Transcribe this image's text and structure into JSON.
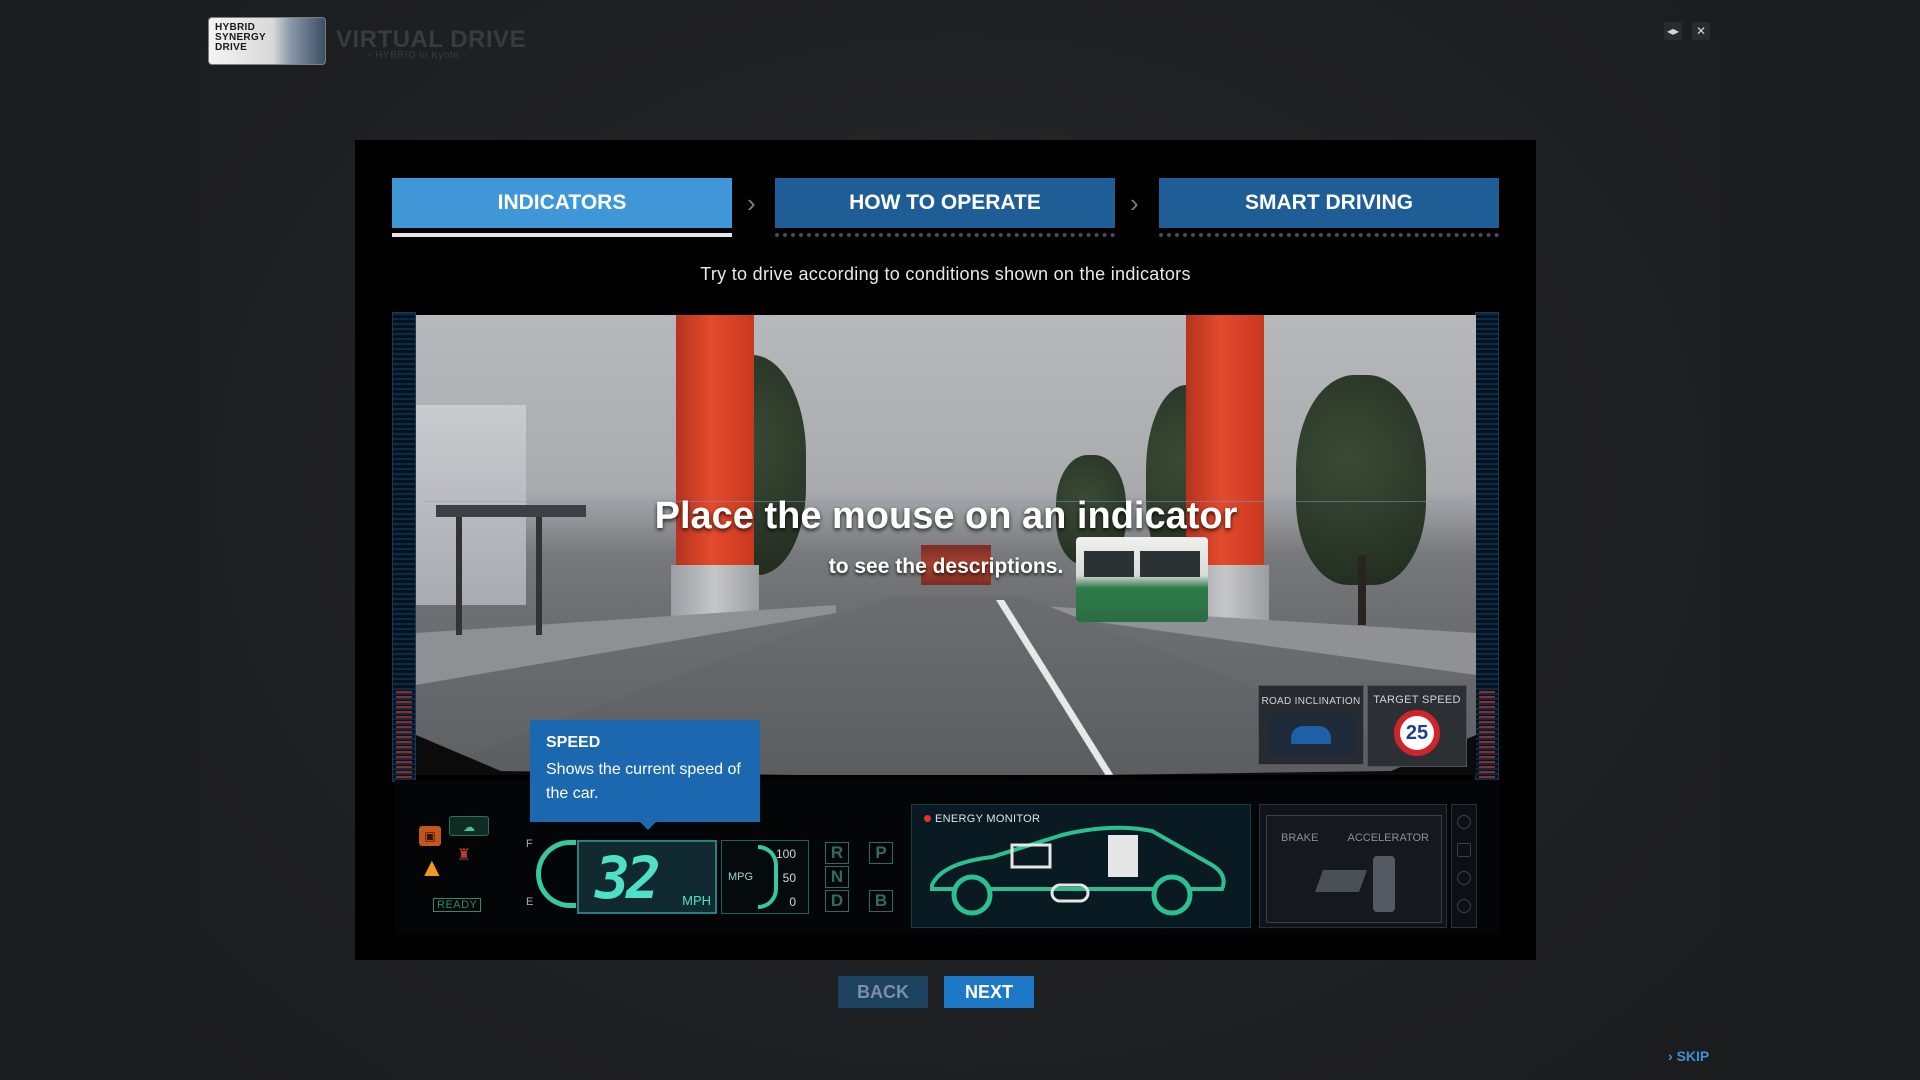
{
  "header": {
    "logo_lines": [
      "HYBRID",
      "SYNERGY",
      "DRIVE"
    ],
    "title": "VIRTUAL DRIVE",
    "subtitle": "- HYBRID in Kyoto -",
    "sound_icon": "sound-icon",
    "close_icon": "close-icon",
    "sound_glyph": "◂▸",
    "close_glyph": "✕"
  },
  "tabs": [
    {
      "label": "INDICATORS",
      "active": true
    },
    {
      "label": "HOW TO OPERATE",
      "active": false
    },
    {
      "label": "SMART DRIVING",
      "active": false
    }
  ],
  "tab_separator": "›",
  "instruction": "Try to drive according to conditions shown on the indicators",
  "scene": {
    "headline": "Place the mouse on an indicator",
    "subline": "to see the descriptions."
  },
  "tooltip": {
    "title": "SPEED",
    "description": "Shows the current speed of the car."
  },
  "overlays": {
    "road_inclination_label": "ROAD INCLINATION",
    "target_speed_label": "TARGET SPEED",
    "target_speed_value": "25"
  },
  "cluster": {
    "ready_label": "READY",
    "fuel_full": "F",
    "fuel_empty": "E",
    "speed_value": "32",
    "speed_unit": "MPH",
    "mpg_label": "MPG",
    "mpg_scale": [
      "100",
      "50",
      "0"
    ],
    "shift_positions": [
      "R",
      "P",
      "N",
      "D",
      "B"
    ],
    "energy_monitor_label": "ENERGY MONITOR",
    "brake_label": "BRAKE",
    "accelerator_label": "ACCELERATOR"
  },
  "buttons": {
    "back": "BACK",
    "next": "NEXT",
    "skip": "SKIP",
    "skip_glyph": "›"
  },
  "colors": {
    "tab_active": "#3f97d8",
    "tab_inactive": "#1f5d97",
    "tooltip_bg": "#1b68b0",
    "speed_digits": "#4fe0c8",
    "next_button": "#1d79c6",
    "skip_link": "#3e8fd8"
  }
}
